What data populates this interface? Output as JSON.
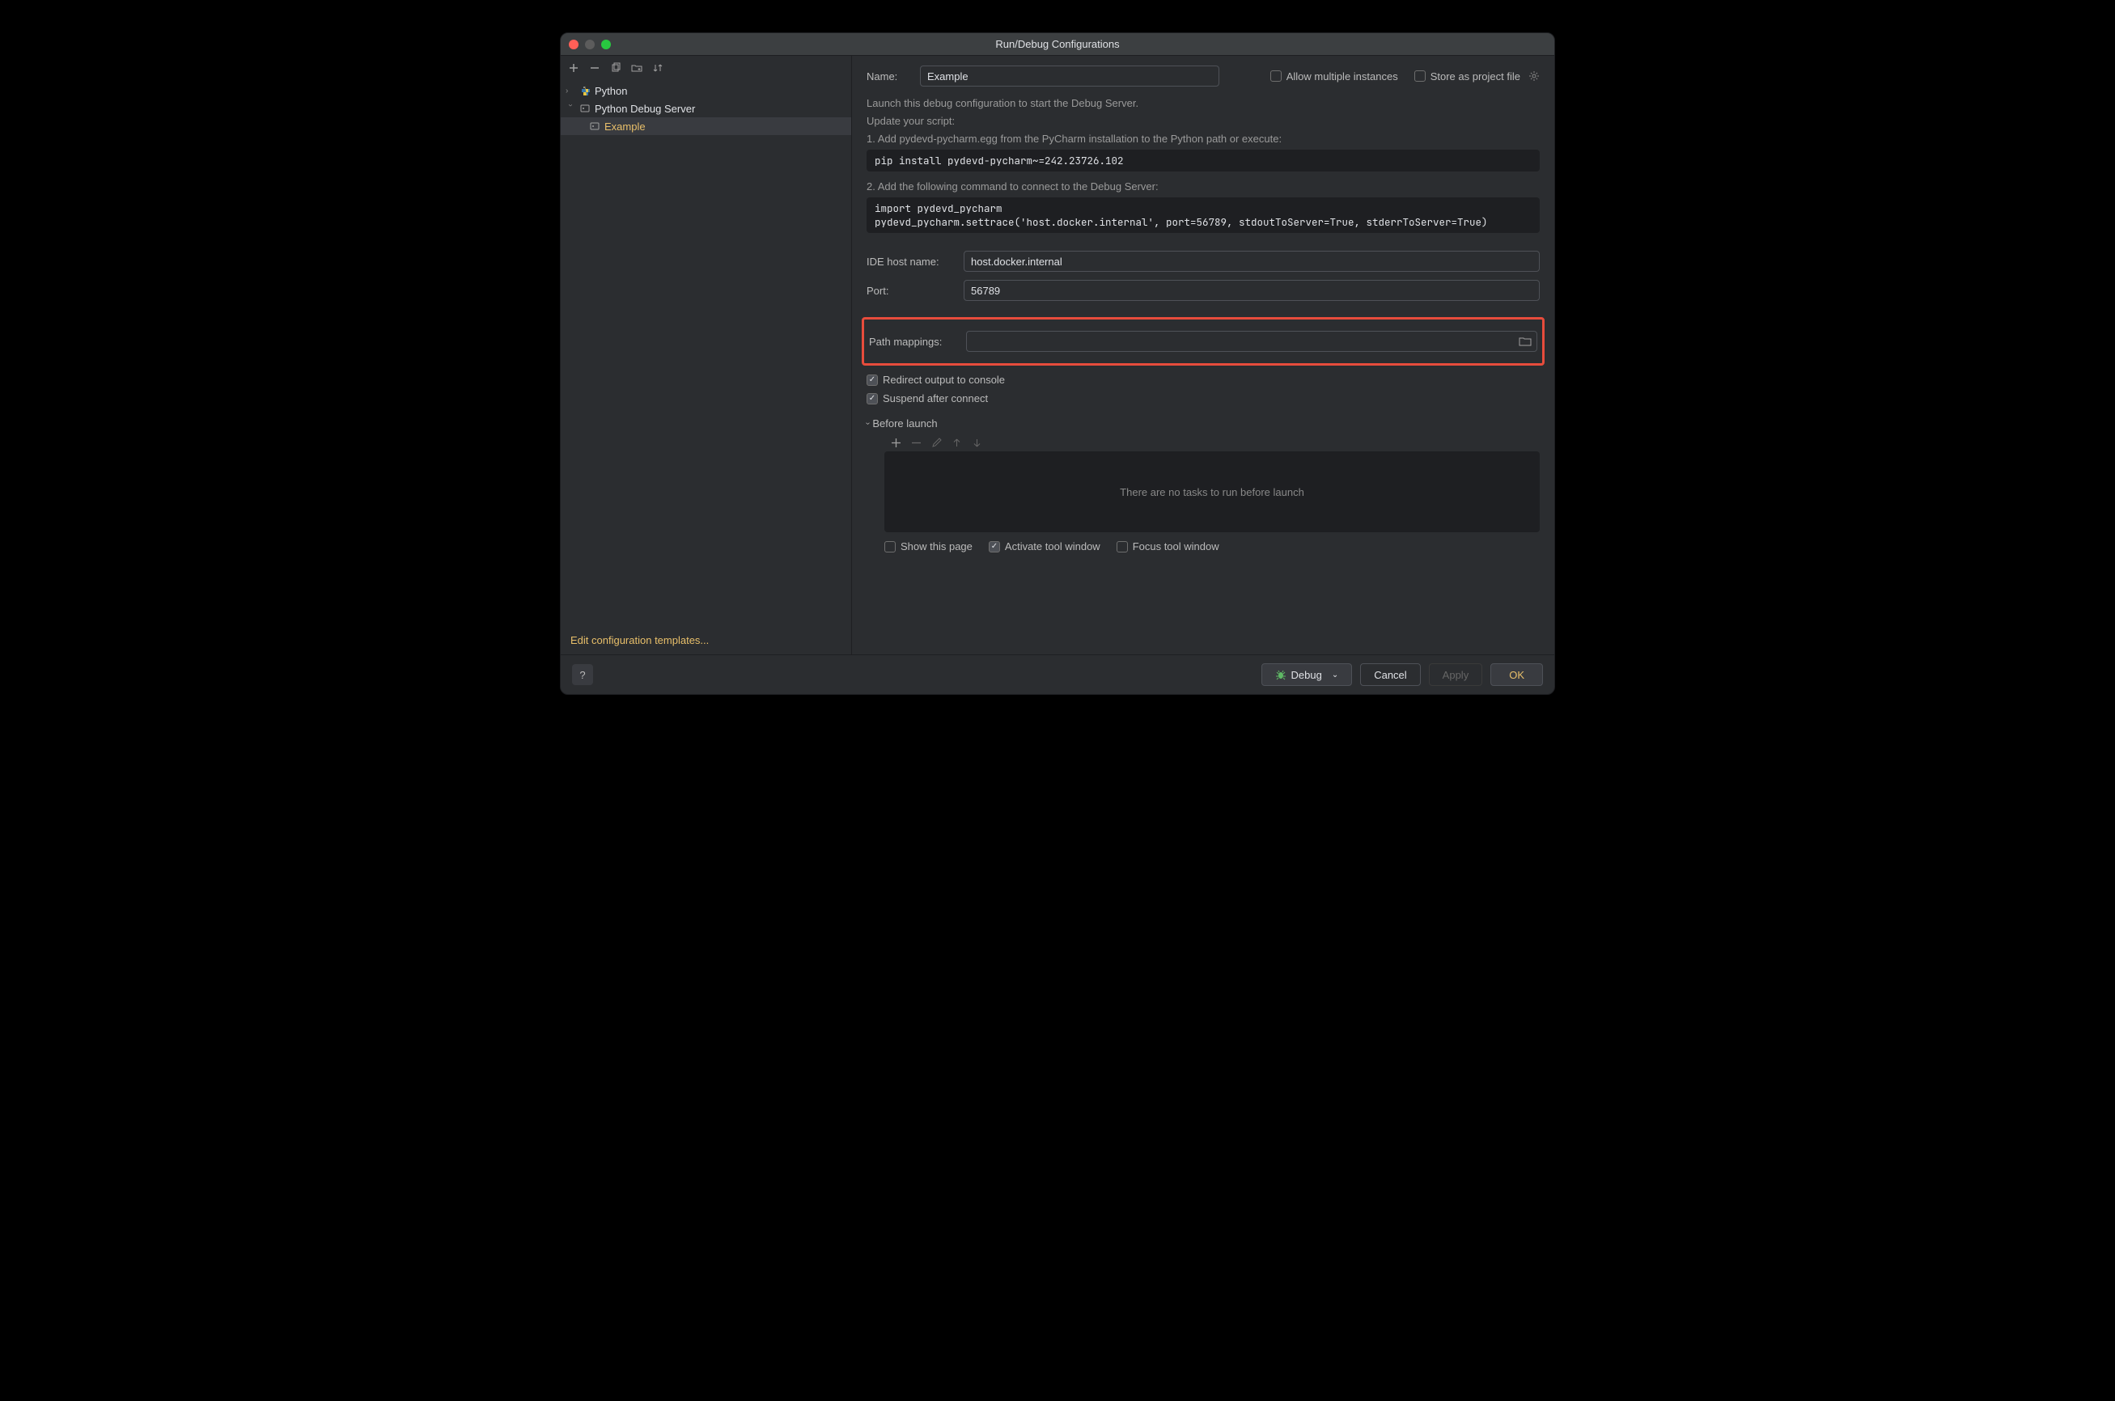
{
  "window": {
    "title": "Run/Debug Configurations"
  },
  "sidebar": {
    "tree": {
      "python_label": "Python",
      "debug_server_label": "Python Debug Server",
      "example_label": "Example"
    },
    "edit_templates": "Edit configuration templates..."
  },
  "form": {
    "name_label": "Name:",
    "name_value": "Example",
    "allow_multiple": "Allow multiple instances",
    "store_as_project": "Store as project file",
    "launch_helper": "Launch this debug configuration to start the Debug Server.",
    "update_script": "Update your script:",
    "step1": "1. Add pydevd-pycharm.egg from the PyCharm installation to the Python path or execute:",
    "code1": "pip install pydevd-pycharm~=242.23726.102",
    "step2": "2. Add the following command to connect to the Debug Server:",
    "code2": "import pydevd_pycharm\npydevd_pycharm.settrace('host.docker.internal', port=56789, stdoutToServer=True, stderrToServer=True)",
    "ide_host_label": "IDE host name:",
    "ide_host_value": "host.docker.internal",
    "port_label": "Port:",
    "port_value": "56789",
    "path_mappings_label": "Path mappings:",
    "redirect_output": "Redirect output to console",
    "suspend_after": "Suspend after connect",
    "before_launch": "Before launch",
    "no_tasks": "There are no tasks to run before launch",
    "show_this_page": "Show this page",
    "activate_tool": "Activate tool window",
    "focus_tool": "Focus tool window"
  },
  "footer": {
    "debug": "Debug",
    "cancel": "Cancel",
    "apply": "Apply",
    "ok": "OK"
  }
}
